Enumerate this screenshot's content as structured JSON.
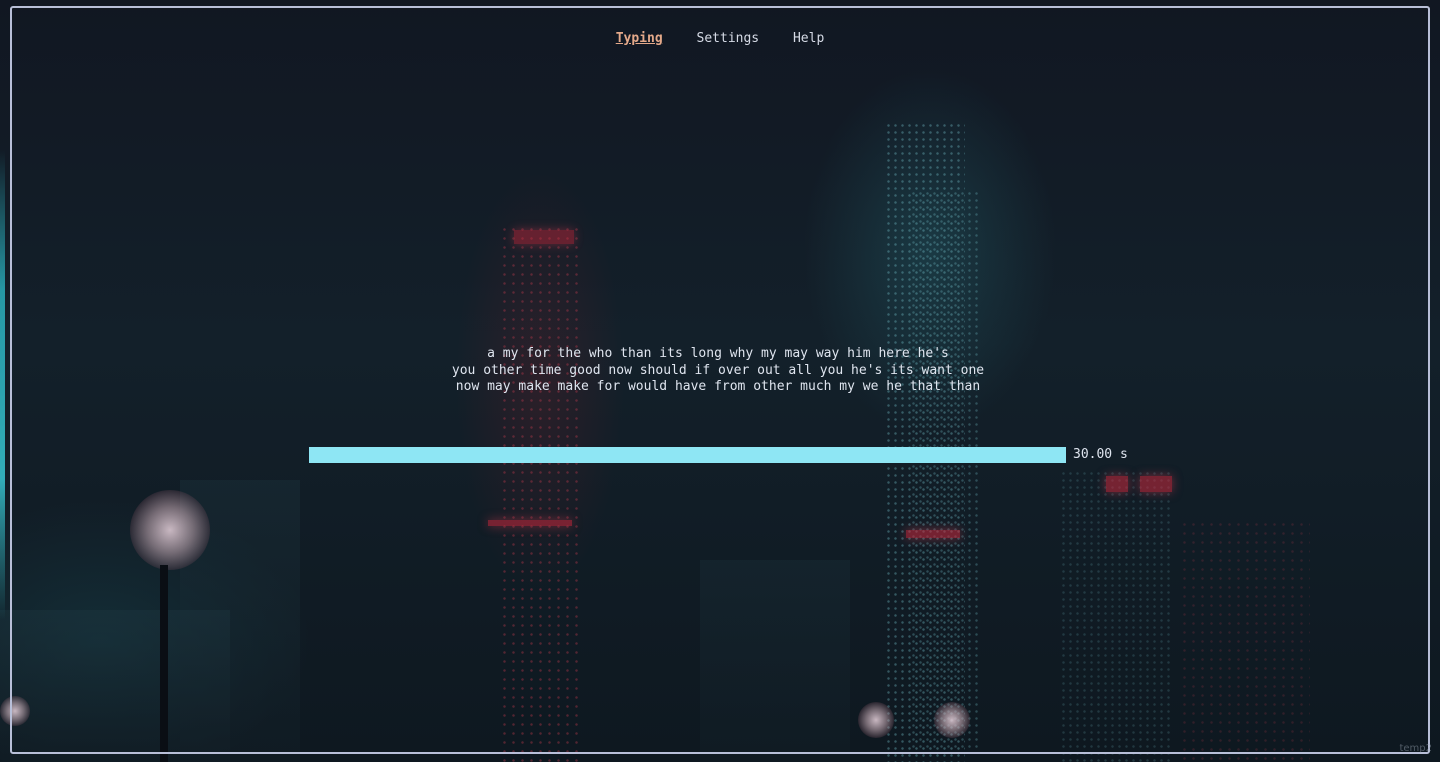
{
  "nav": {
    "tabs": [
      {
        "label": "Typing",
        "active": true
      },
      {
        "label": "Settings",
        "active": false
      },
      {
        "label": "Help",
        "active": false
      }
    ]
  },
  "typing": {
    "lines": [
      "a my for the who than its long why my may way him here he's",
      "you other time good now should if over out all you he's its want one",
      "now may make make for would have from other much my we he that than"
    ]
  },
  "timer": {
    "label": "30.00 s",
    "remaining_fraction": 1.0,
    "bar_color": "#8ee6f4"
  },
  "accent": {
    "active_tab_color": "#e4a98a",
    "frame_border_color": "#b8bfd8"
  },
  "watermark": "temp2"
}
